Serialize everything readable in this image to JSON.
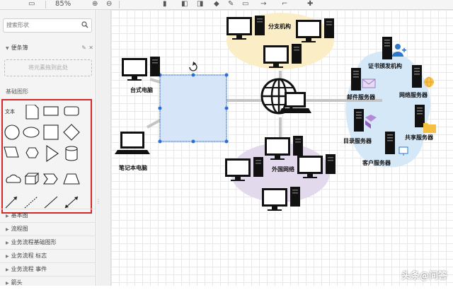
{
  "toolbar": {
    "zoom": "85%"
  },
  "sidebar": {
    "search_placeholder": "搜索形状",
    "scratchpad_label": "便条簿",
    "dropzone_text": "将元素拖到此处",
    "basic_shapes_label": "基础图形",
    "text_shape_label": "文本",
    "categories": [
      {
        "label": "基本图"
      },
      {
        "label": "流程图"
      },
      {
        "label": "业务流程基础图形"
      },
      {
        "label": "业务流程 标志"
      },
      {
        "label": "业务流程 事件"
      },
      {
        "label": "箭头"
      }
    ]
  },
  "canvas": {
    "labels": {
      "desktop": "台式电脑",
      "laptop": "笔记本电脑",
      "branch": "分支机构",
      "foreign": "外国网络",
      "cert": "证书颁发机构",
      "mail": "邮件服务器",
      "web": "网络服务器",
      "directory": "目录服务器",
      "share": "共享服务器",
      "client": "客户服务器"
    }
  },
  "watermark": "头条@问答"
}
